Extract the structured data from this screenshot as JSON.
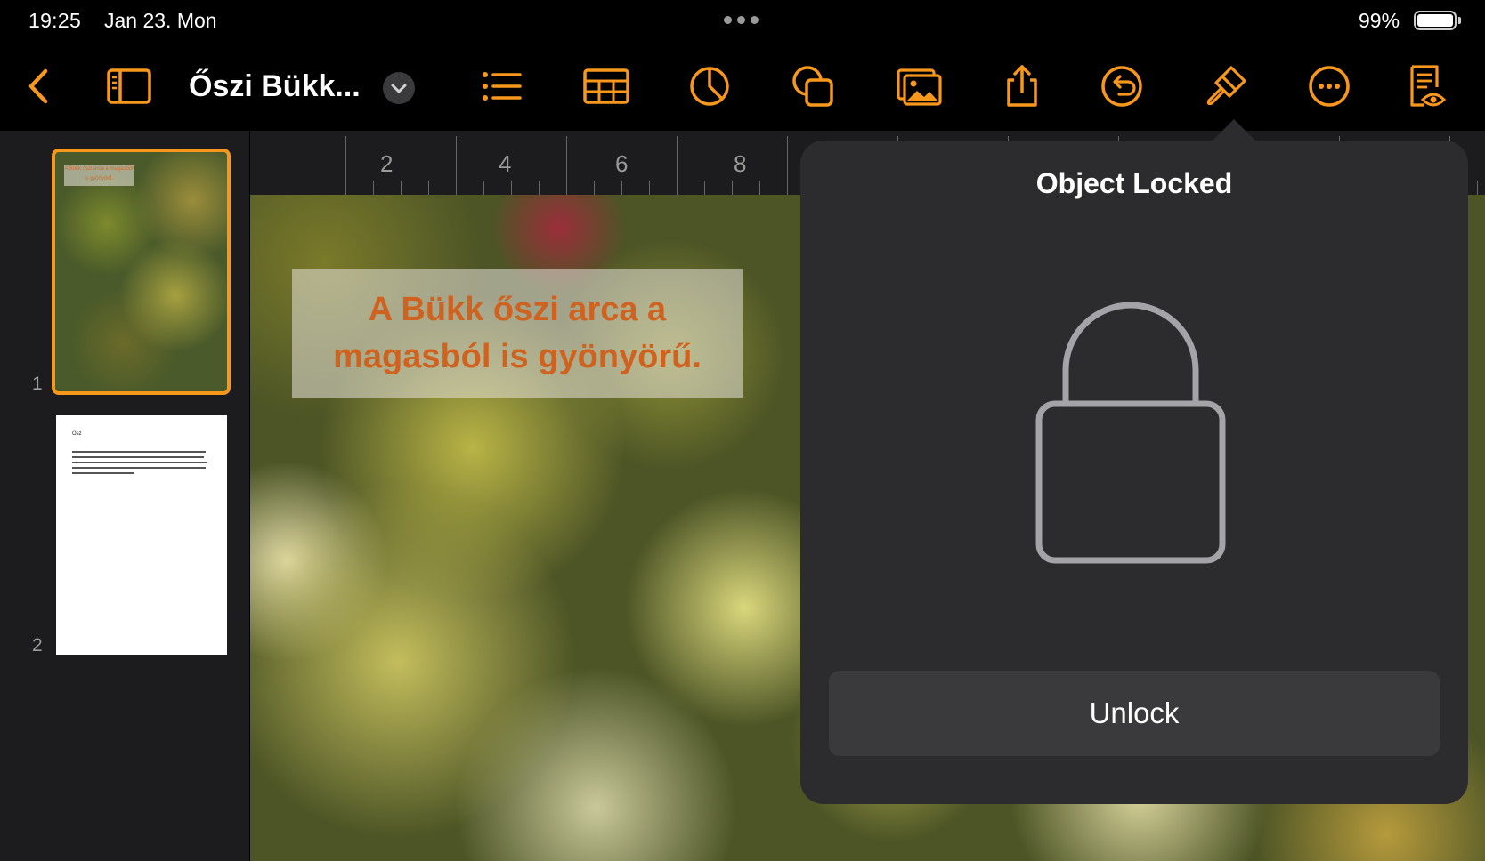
{
  "status_bar": {
    "time": "19:25",
    "date": "Jan 23. Mon",
    "battery": "99%",
    "battery_level": 0.99
  },
  "toolbar": {
    "document_title": "Őszi Bükk...",
    "icons": [
      "back-chevron-icon",
      "sidebar-icon",
      "title-dropdown-chevron-icon",
      "list-icon",
      "table-icon",
      "chart-icon",
      "shapes-icon",
      "media-icon",
      "share-icon",
      "undo-icon",
      "format-brush-icon",
      "more-icon",
      "document-options-icon"
    ],
    "accent_color": "#f7981d"
  },
  "sidebar": {
    "pages": [
      {
        "number": "1",
        "caption": "A Bükk őszi arca a magasból is gyönyörű.",
        "selected": true
      },
      {
        "number": "2",
        "title": "Ősz"
      }
    ]
  },
  "ruler": {
    "labels": [
      "2",
      "4",
      "6",
      "8"
    ]
  },
  "canvas": {
    "caption_line1": "A Bükk őszi arca a",
    "caption_line2": "magasból is gyönyörű."
  },
  "popover": {
    "title": "Object Locked",
    "icon": "lock-icon",
    "button_label": "Unlock"
  }
}
